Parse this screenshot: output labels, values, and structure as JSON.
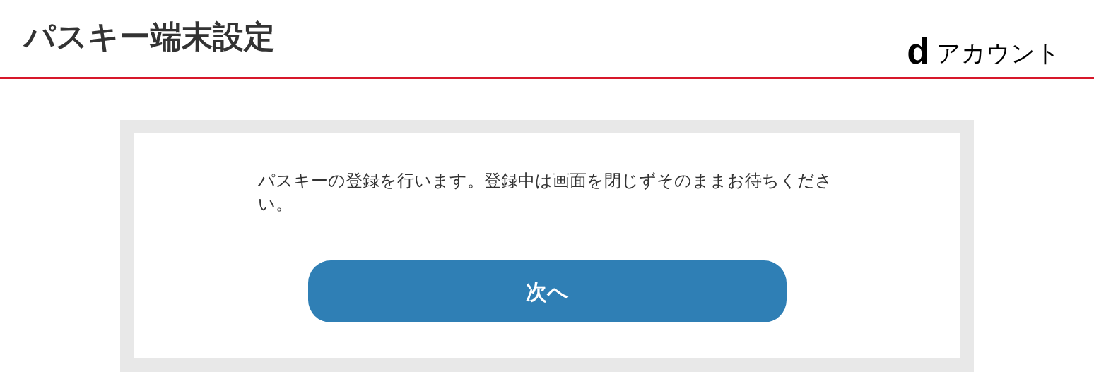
{
  "header": {
    "title": "パスキー端末設定",
    "logo_mark": "d",
    "logo_text": "アカウント"
  },
  "card": {
    "message": "パスキーの登録を行います。登録中は画面を閉じずそのままお待ちください。",
    "button": "次へ"
  }
}
